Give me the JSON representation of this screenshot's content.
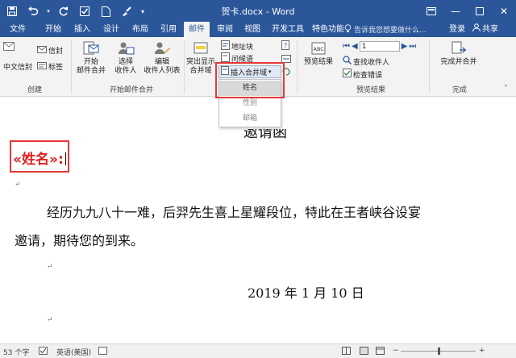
{
  "window": {
    "title": "贺卡.docx - Word"
  },
  "tabs": [
    "文件",
    "开始",
    "插入",
    "设计",
    "布局",
    "引用",
    "邮件",
    "审阅",
    "视图",
    "开发工具",
    "特色功能"
  ],
  "active_tab": "邮件",
  "tell_me": "告诉我您想要做什么...",
  "account": {
    "login": "登录",
    "share": "共享"
  },
  "ribbon": {
    "create": {
      "label": "创建",
      "chinese_envelope": "中文信封",
      "envelope": "信封",
      "labels": "标签"
    },
    "start_merge": {
      "label": "开始邮件合并",
      "start": [
        "开始",
        "邮件合并"
      ],
      "select": [
        "选择",
        "收件人"
      ],
      "edit": [
        "编辑",
        "收件人列表"
      ]
    },
    "write_insert": {
      "highlight": [
        "突出显示",
        "合并域"
      ],
      "address_block": "地址块",
      "greeting_line": "问候语",
      "insert_merge_field": "插入合并域"
    },
    "preview": {
      "label": "预览结果",
      "preview_results": "预览结果",
      "record": "1",
      "find_recipient": "查找收件人",
      "check_errors": "检查错误"
    },
    "finish": {
      "label": "完成",
      "finish_merge": [
        "完成并合并"
      ]
    }
  },
  "dropdown": {
    "items": [
      "姓名",
      "性别",
      "邮箱"
    ]
  },
  "document": {
    "heading_partial": "邀请函",
    "merge_field": "«姓名»:",
    "body_line1": "经历九九八十一难，后羿先生喜上星耀段位，特此在王者峡谷设宴",
    "body_line2": "邀请，期待您的到来。",
    "date": "2019 年 1 月 10 日"
  },
  "statusbar": {
    "word_count": "53 个字",
    "language": "英语(美国)"
  },
  "colors": {
    "word_blue": "#2b579a",
    "highlight_red": "#e53935",
    "merge_red": "#e02020"
  }
}
